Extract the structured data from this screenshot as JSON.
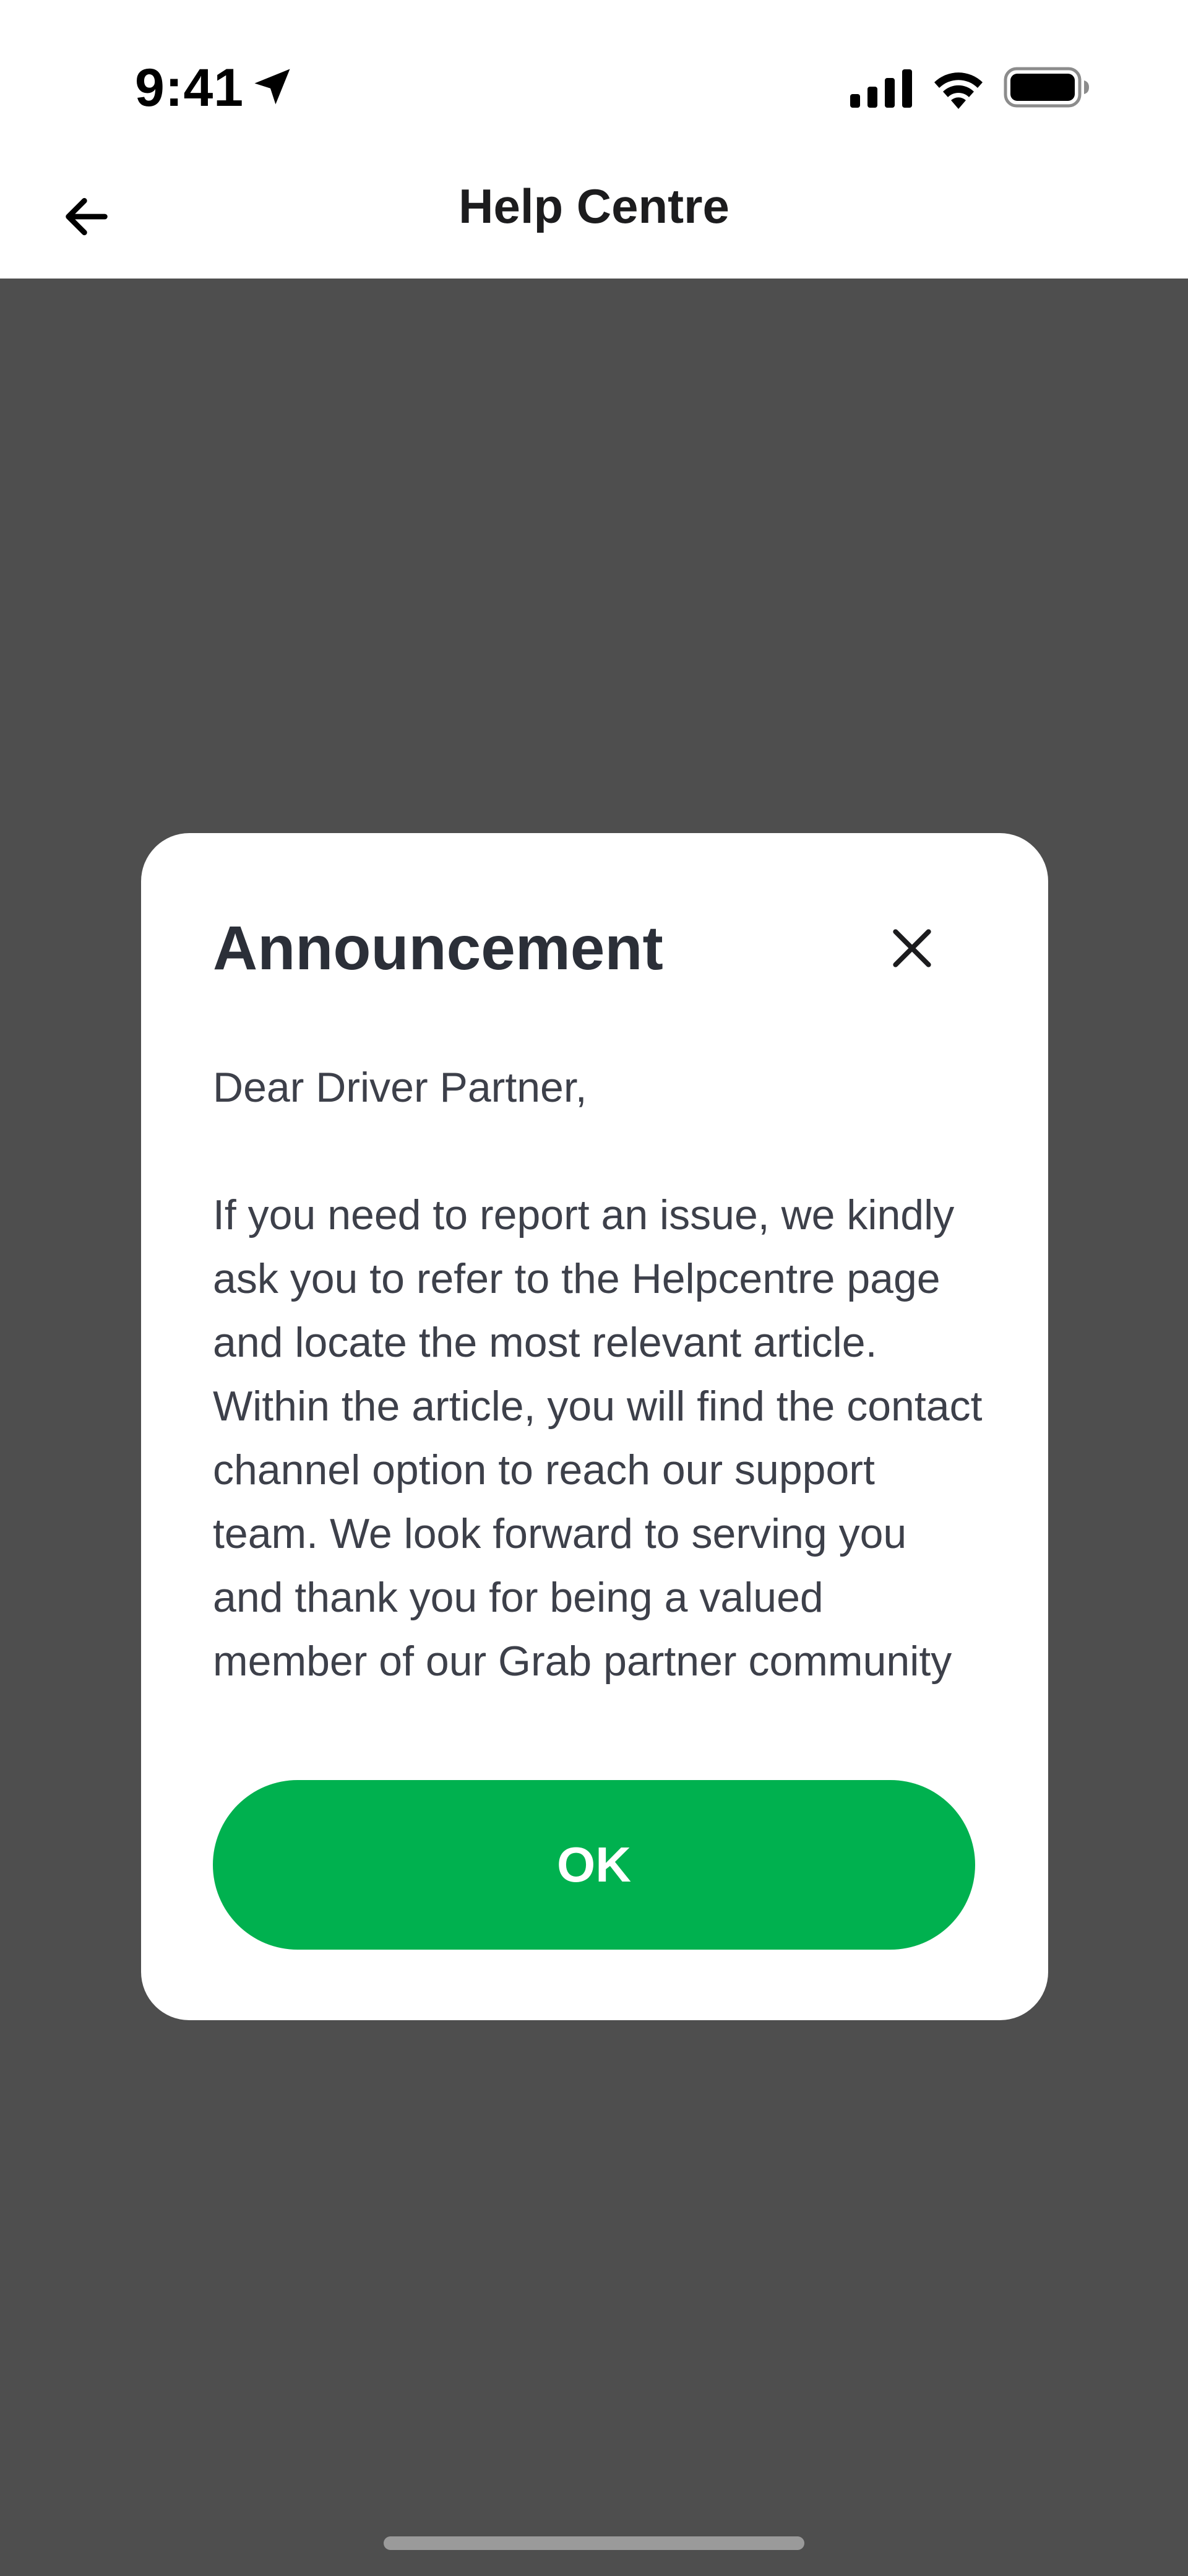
{
  "status_bar": {
    "time": "9:41",
    "icons": [
      "location-arrow-icon",
      "cellular-signal-icon",
      "wifi-icon",
      "battery-icon"
    ]
  },
  "header": {
    "back_icon": "arrow-left-icon",
    "title": "Help Centre"
  },
  "modal": {
    "title": "Announcement",
    "close_icon": "close-icon",
    "greeting": "Dear Driver Partner,",
    "message": "If you need to report an issue, we kindly ask you to refer to the Helpcentre page and locate the most relevant article. Within the article, you will find the contact channel option to reach our support team. We look forward to serving you and thank you for being a valued member of our Grab partner community",
    "ok_label": "OK"
  },
  "colors": {
    "overlay": "#4e4e4e",
    "primary_button": "#00b14f",
    "surface": "#ffffff",
    "text_primary": "#2b2f38",
    "text_body": "#3d404a"
  }
}
